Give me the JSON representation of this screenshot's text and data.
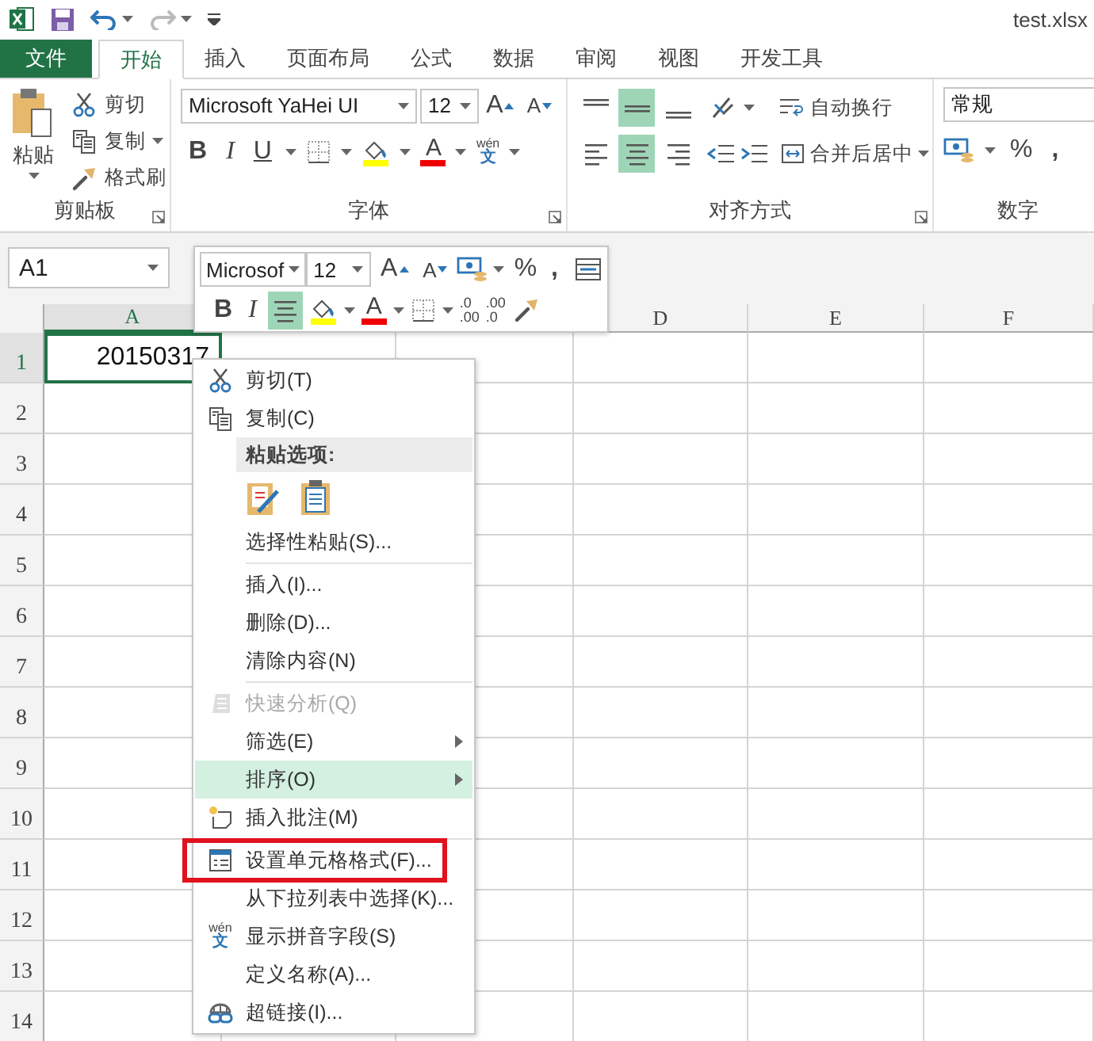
{
  "title_bar": {
    "title": "test.xlsx"
  },
  "ribbon_tabs": [
    {
      "label": "文件",
      "kind": "file",
      "selected": false
    },
    {
      "label": "开始",
      "kind": "tab",
      "selected": true
    },
    {
      "label": "插入",
      "kind": "tab",
      "selected": false
    },
    {
      "label": "页面布局",
      "kind": "tab",
      "selected": false
    },
    {
      "label": "公式",
      "kind": "tab",
      "selected": false
    },
    {
      "label": "数据",
      "kind": "tab",
      "selected": false
    },
    {
      "label": "审阅",
      "kind": "tab",
      "selected": false
    },
    {
      "label": "视图",
      "kind": "tab",
      "selected": false
    },
    {
      "label": "开发工具",
      "kind": "tab",
      "selected": false
    }
  ],
  "clipboard": {
    "label": "剪贴板",
    "paste_label": "粘贴",
    "items": [
      {
        "kind": "cut",
        "label": "剪切"
      },
      {
        "kind": "copy",
        "label": "复制"
      },
      {
        "kind": "format_painter",
        "label": "格式刷"
      }
    ]
  },
  "font": {
    "label": "字体",
    "font_name": "Microsoft YaHei UI",
    "font_size": "12",
    "grow": "A",
    "shrink": "A",
    "bold": "B",
    "italic": "I",
    "underline": "U",
    "font_color": "A",
    "phonetic_top": "wén",
    "phonetic_bottom": "文"
  },
  "alignment": {
    "label": "对齐方式",
    "wrap_label": "自动换行",
    "merge_label": "合并后居中",
    "vertical": [
      {
        "kind": "top",
        "selected": false
      },
      {
        "kind": "middle",
        "selected": true
      },
      {
        "kind": "bottom",
        "selected": false
      }
    ],
    "horizontal": [
      {
        "kind": "left",
        "selected": false
      },
      {
        "kind": "center",
        "selected": true
      },
      {
        "kind": "right",
        "selected": false
      }
    ]
  },
  "number": {
    "label": "数字",
    "format": "常规",
    "percent": "%",
    "comma": ","
  },
  "name_box": {
    "value": "A1"
  },
  "mini_toolbar": {
    "font_name": "Microsof",
    "font_size": "12",
    "grow": "A",
    "shrink": "A",
    "percent": "%",
    "comma": ",",
    "bold": "B",
    "italic": "I",
    "center_selected": true,
    "font_color": "A",
    "increase_decimal": {
      "top": ".0",
      "bottom": ".00"
    },
    "decrease_decimal": {
      "top": ".00",
      "bottom": ".0"
    }
  },
  "sheet": {
    "columns": [
      {
        "label": "A",
        "selected": true
      },
      {},
      {},
      {
        "label": "D",
        "selected": false
      },
      {
        "label": "E",
        "selected": false
      },
      {
        "label": "F",
        "selected": false
      }
    ],
    "rows": [
      {
        "label": "1",
        "selected": true,
        "cells": [
          "20150317"
        ]
      },
      {
        "label": "2",
        "selected": false
      },
      {
        "label": "3",
        "selected": false
      },
      {
        "label": "4",
        "selected": false
      },
      {
        "label": "5",
        "selected": false
      },
      {
        "label": "6",
        "selected": false
      },
      {
        "label": "7",
        "selected": false
      },
      {
        "label": "8",
        "selected": false
      },
      {
        "label": "9",
        "selected": false
      },
      {
        "label": "10",
        "selected": false
      },
      {
        "label": "11",
        "selected": false
      },
      {
        "label": "12",
        "selected": false
      },
      {
        "label": "13",
        "selected": false
      },
      {
        "label": "14",
        "selected": false
      }
    ]
  },
  "context_menu": [
    {
      "kind": "cut",
      "label": "剪切(T)",
      "selected": false,
      "disabled": false,
      "submenu": false
    },
    {
      "kind": "copy",
      "label": "复制(C)",
      "selected": false,
      "disabled": false,
      "submenu": false
    },
    {
      "kind": "header",
      "label": "粘贴选项:"
    },
    {
      "kind": "paste_icons"
    },
    {
      "kind": "plain",
      "label": "选择性粘贴(S)...",
      "selected": false,
      "disabled": false,
      "submenu": false
    },
    {
      "kind": "separator"
    },
    {
      "kind": "plain",
      "label": "插入(I)...",
      "selected": false,
      "disabled": false,
      "submenu": false
    },
    {
      "kind": "plain",
      "label": "删除(D)...",
      "selected": false,
      "disabled": false,
      "submenu": false
    },
    {
      "kind": "plain",
      "label": "清除内容(N)",
      "selected": false,
      "disabled": false,
      "submenu": false
    },
    {
      "kind": "separator"
    },
    {
      "kind": "quick_analysis",
      "label": "快速分析(Q)",
      "selected": false,
      "disabled": true,
      "submenu": false
    },
    {
      "kind": "plain",
      "label": "筛选(E)",
      "selected": false,
      "disabled": false,
      "submenu": true
    },
    {
      "kind": "plain",
      "label": "排序(O)",
      "selected": true,
      "disabled": false,
      "submenu": true
    },
    {
      "kind": "comment",
      "label": "插入批注(M)",
      "selected": false,
      "disabled": false,
      "submenu": false
    },
    {
      "kind": "separator"
    },
    {
      "kind": "format_cells",
      "label": "设置单元格格式(F)...",
      "selected": false,
      "disabled": false,
      "submenu": false,
      "highlighted": true
    },
    {
      "kind": "plain",
      "label": "从下拉列表中选择(K)...",
      "selected": false,
      "disabled": false,
      "submenu": false
    },
    {
      "kind": "phonetic",
      "label": "显示拼音字段(S)",
      "selected": false,
      "disabled": false,
      "submenu": false,
      "glyph_top": "wén",
      "glyph_bottom": "文"
    },
    {
      "kind": "plain",
      "label": "定义名称(A)...",
      "selected": false,
      "disabled": false,
      "submenu": false
    },
    {
      "kind": "hyperlink",
      "label": "超链接(I)...",
      "selected": false,
      "disabled": false,
      "submenu": false
    }
  ]
}
